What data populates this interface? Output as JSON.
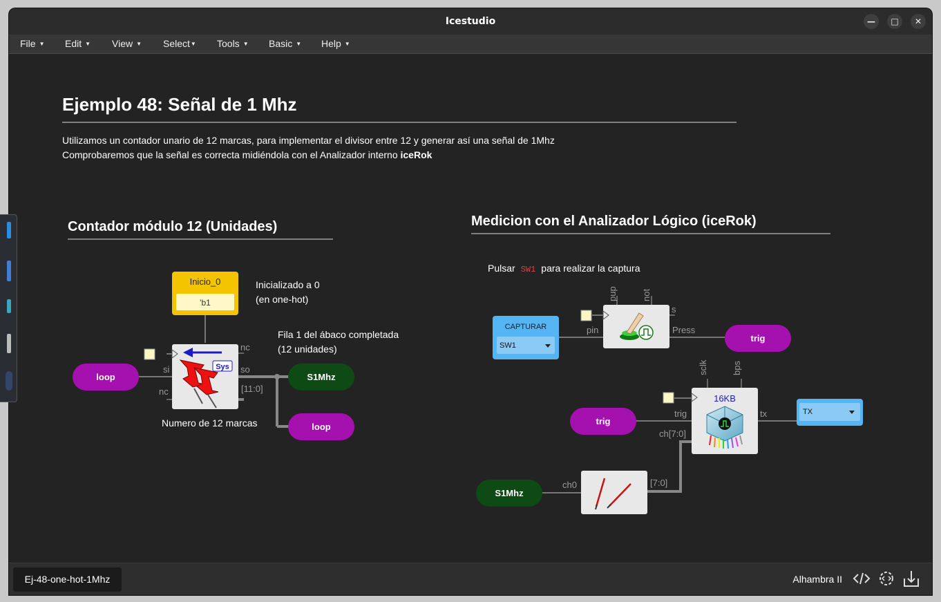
{
  "window": {
    "title": "Icestudio"
  },
  "menu": [
    "File",
    "Edit",
    "View",
    "Select",
    "Tools",
    "Basic",
    "Help"
  ],
  "doc": {
    "title": "Ejemplo 48: Señal de 1 Mhz",
    "line1": "Utilizamos un contador unario de 12 marcas, para implementar el divisor entre 12 y generar así una señal de 1Mhz",
    "line2_prefix": "Comprobaremos que la señal es correcta midiéndola con el Analizador interno ",
    "line2_bold": "iceRok"
  },
  "left": {
    "heading": "Contador módulo 12 (Unidades)",
    "const_name": "Inicio_0",
    "const_value": "'b1",
    "note_a1": "Inicializado a 0",
    "note_a2": "(en one-hot)",
    "note_b1": "Fila 1 del ábaco completada",
    "note_b2": "(12 unidades)",
    "caption": "Numero de 12 marcas",
    "sys_label": "Sys",
    "ports": {
      "nc_top": "nc",
      "si": "si",
      "nc_bot": "nc",
      "so": "so",
      "bus": "[11:0]"
    },
    "pill_in": "loop",
    "pill_out1": "S1Mhz",
    "pill_out2": "loop"
  },
  "right": {
    "heading": "Medicion con el Analizador Lógico (iceRok)",
    "instr_pre": "Pulsar",
    "instr_code": "SW1",
    "instr_post": "para realizar la captura",
    "input_label": "CAPTURAR",
    "input_value": "SW1",
    "btn_ports": {
      "pin": "pin",
      "pup": "pup",
      "not": "not",
      "s": "s",
      "press": "Press"
    },
    "trig_out": "trig",
    "trig_in": "trig",
    "rok_label": "16KB",
    "rok_ports": {
      "sclk": "sclk",
      "bps": "bps",
      "trig": "trig",
      "ch": "ch[7:0]",
      "tx": "tx"
    },
    "output_value": "TX",
    "s1mhz": "S1Mhz",
    "probe_ports": {
      "ch0": "ch0",
      "bus": "[7:0]"
    }
  },
  "footer": {
    "tab": "Ej-48-one-hot-1Mhz",
    "board": "Alhambra II"
  },
  "colors": {
    "pill_purple": "#a511ae",
    "pill_green": "#0e4a14",
    "const_yellow": "#f5c400",
    "io_blue": "#55b4f2"
  }
}
